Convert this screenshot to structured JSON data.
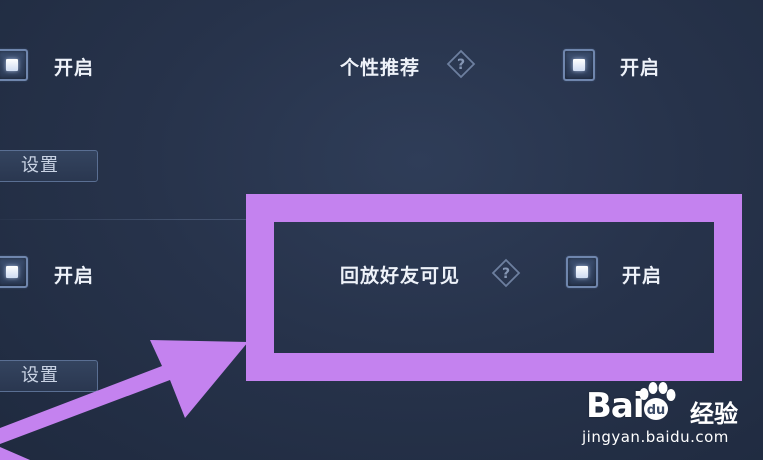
{
  "rows": {
    "row1": {
      "left_toggle_label": "开启",
      "right_setting_label": "个性推荐",
      "right_toggle_label": "开启",
      "settings_button": "设置"
    },
    "row2": {
      "left_toggle_label": "开启",
      "right_setting_label": "回放好友可见",
      "right_toggle_label": "开启",
      "settings_button": "设置"
    }
  },
  "watermark": {
    "brand": "Bai",
    "brand_suffix": "du",
    "product": "经验",
    "url": "jingyan.baidu.com"
  },
  "colors": {
    "highlight": "#c482ef",
    "background": "#27334b"
  }
}
